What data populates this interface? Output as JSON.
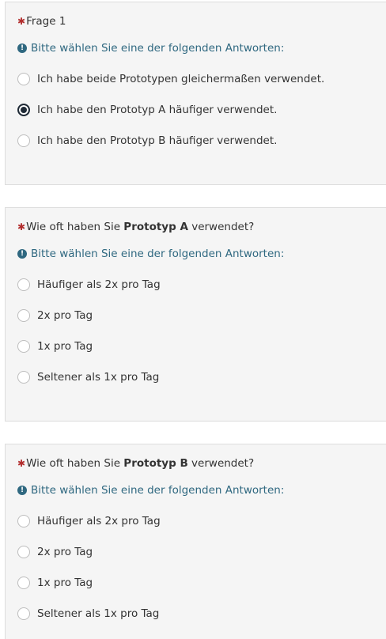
{
  "questions": [
    {
      "prefix": "",
      "title": "Frage 1",
      "bold": "",
      "suffix": "",
      "help": "Bitte wählen Sie eine der folgenden Antworten:",
      "options": [
        {
          "label": "Ich habe beide Prototypen gleichermaßen verwendet.",
          "checked": false
        },
        {
          "label": "Ich habe den Prototyp A häufiger verwendet.",
          "checked": true
        },
        {
          "label": "Ich habe den Prototyp B häufiger verwendet.",
          "checked": false
        }
      ]
    },
    {
      "prefix": "Wie oft haben Sie ",
      "bold": "Prototyp A",
      "suffix": " verwendet?",
      "help": "Bitte wählen Sie eine der folgenden Antworten:",
      "options": [
        {
          "label": "Häufiger als 2x pro Tag",
          "checked": false
        },
        {
          "label": "2x pro Tag",
          "checked": false
        },
        {
          "label": "1x pro Tag",
          "checked": false
        },
        {
          "label": "Seltener als 1x pro Tag",
          "checked": false
        }
      ]
    },
    {
      "prefix": "Wie oft haben Sie ",
      "bold": "Prototyp B",
      "suffix": " verwendet?",
      "help": "Bitte wählen Sie eine der folgenden Antworten:",
      "options": [
        {
          "label": "Häufiger als 2x pro Tag",
          "checked": false
        },
        {
          "label": "2x pro Tag",
          "checked": false
        },
        {
          "label": "1x pro Tag",
          "checked": false
        },
        {
          "label": "Seltener als 1x pro Tag",
          "checked": false
        }
      ]
    }
  ],
  "asterisk": "✱",
  "help_icon_glyph": "!",
  "colors": {
    "accent": "#2f6880",
    "required": "#b22d2d",
    "radio_checked": "#1f2a36",
    "card_bg": "#f5f5f5"
  }
}
